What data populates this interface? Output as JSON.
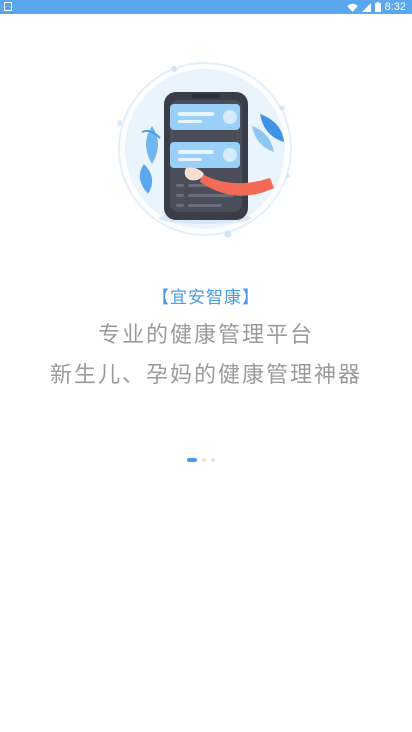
{
  "status_bar": {
    "time": "8:32",
    "icons": [
      "notification-icon",
      "wifi-icon",
      "signal-icon",
      "battery-icon"
    ]
  },
  "onboarding": {
    "brand": "【宜安智康】",
    "tagline_line1": "专业的健康管理平台",
    "tagline_line2": "新生儿、孕妈的健康管理神器",
    "pager": {
      "total": 3,
      "current": 1
    }
  },
  "colors": {
    "status_bar": "#5aa7ee",
    "accent": "#4a9cea",
    "tagline": "#9b9b9b"
  }
}
